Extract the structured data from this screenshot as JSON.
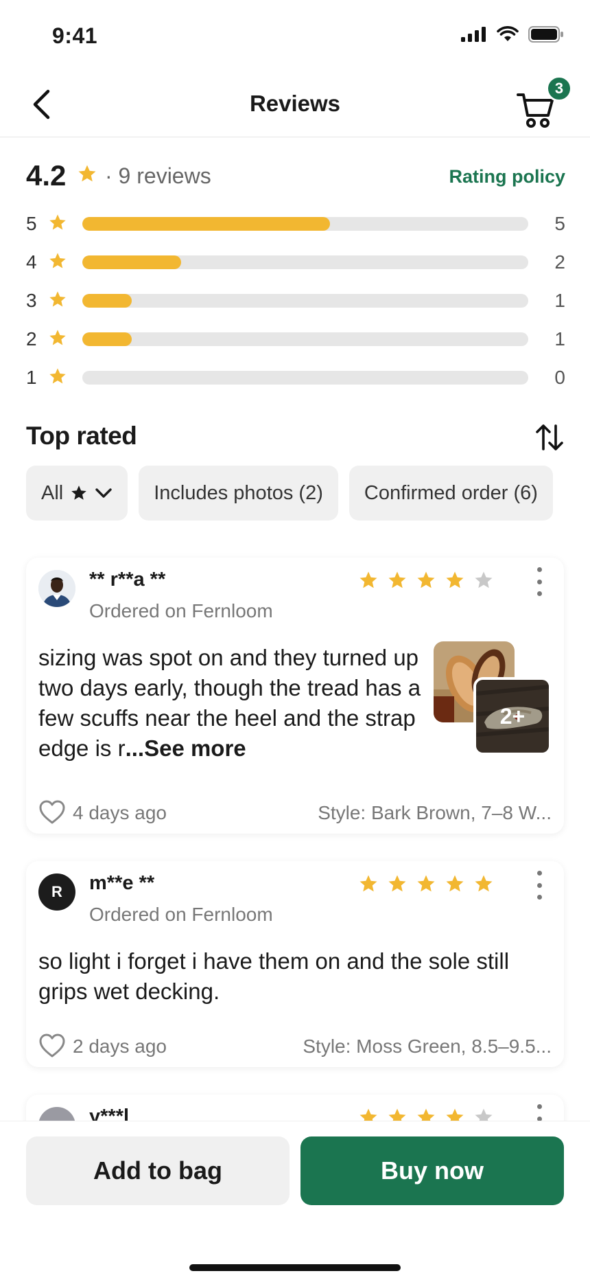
{
  "status_bar": {
    "time": "9:41"
  },
  "nav": {
    "title": "Reviews",
    "cart_count": "3"
  },
  "summary": {
    "score": "4.2",
    "count_text": "· 9 reviews",
    "rating_policy": "Rating policy"
  },
  "distribution": [
    {
      "stars": "5",
      "count": "5",
      "fraction": 0.556
    },
    {
      "stars": "4",
      "count": "2",
      "fraction": 0.222
    },
    {
      "stars": "3",
      "count": "1",
      "fraction": 0.111
    },
    {
      "stars": "2",
      "count": "1",
      "fraction": 0.111
    },
    {
      "stars": "1",
      "count": "0",
      "fraction": 0
    }
  ],
  "sort_section": {
    "title": "Top rated"
  },
  "filters": {
    "all_label": "All",
    "chips": [
      "Includes photos (2)",
      "Confirmed order (6)"
    ]
  },
  "reviews": [
    {
      "name": "** r**a **",
      "ordered_on": "Ordered on Fernloom",
      "rating": 4,
      "text": "sizing was spot on and they turned up two days early, though the tread has a few scuffs near the heel and the strap edge is r",
      "see_more": "...See more",
      "photo_more": "2+",
      "date": "4 days ago",
      "style": "Style: Bark Brown, 7–8 W..."
    },
    {
      "name": "m**e **",
      "avatar_letter": "R",
      "ordered_on": "Ordered on Fernloom",
      "rating": 5,
      "text": "so light i forget i have them on and the sole still grips wet decking.",
      "date": "2 days ago",
      "style": "Style: Moss Green, 8.5–9.5..."
    },
    {
      "name": "y***l",
      "rating": 4
    }
  ],
  "actions": {
    "add_to_bag": "Add to bag",
    "buy_now": "Buy now"
  },
  "colors": {
    "accent": "#1b7550",
    "star": "#f2b731",
    "star_empty": "#c8c8c8"
  }
}
